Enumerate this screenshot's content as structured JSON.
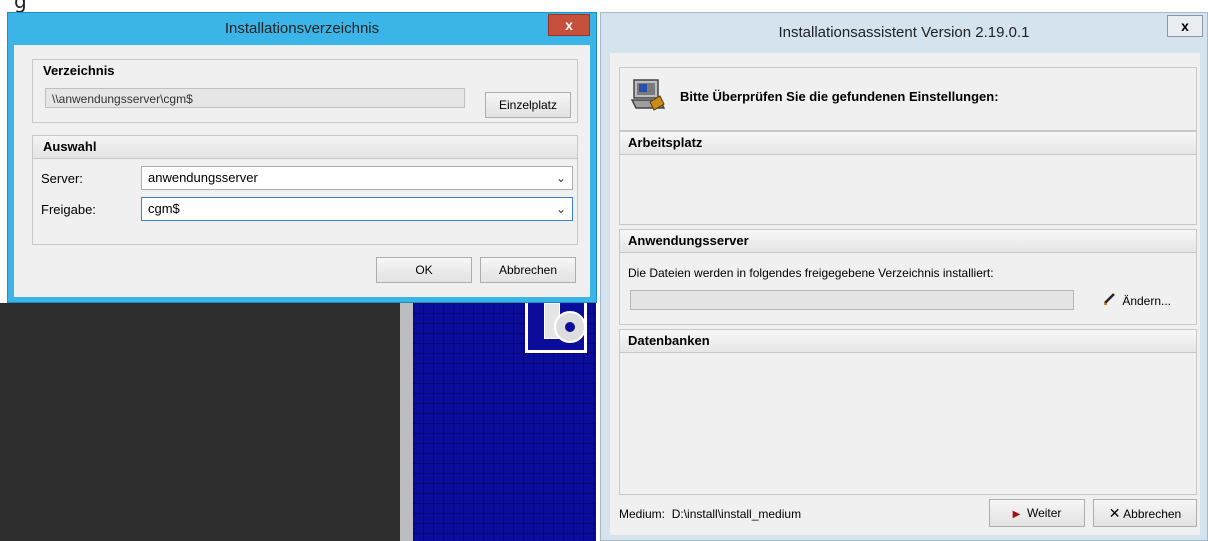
{
  "background": {
    "snippet_text": "g"
  },
  "dialog_directory": {
    "title": "Installationsverzeichnis",
    "close_label": "x",
    "group_directory": {
      "heading": "Verzeichnis",
      "path_value": "\\\\anwendungsserver\\cgm$",
      "single_button": "Einzelplatz"
    },
    "group_selection": {
      "heading": "Auswahl",
      "server_label": "Server:",
      "server_value": "anwendungsserver",
      "share_label": "Freigabe:",
      "share_value": "cgm$"
    },
    "ok_button": "OK",
    "cancel_button": "Abbrechen"
  },
  "dialog_wizard": {
    "title": "Installationsassistent  Version 2.19.0.1",
    "close_label": "x",
    "header_text": "Bitte Überprüfen Sie die gefundenen Einstellungen:",
    "section_workstation": {
      "heading": "Arbeitsplatz"
    },
    "section_appserver": {
      "heading": "Anwendungsserver",
      "description": "Die Dateien werden in folgendes freigegebene Verzeichnis installiert:",
      "path_value": "",
      "change_button": "Ändern..."
    },
    "section_databases": {
      "heading": "Datenbanken"
    },
    "medium_label": "Medium:",
    "medium_value": "D:\\install\\install_medium",
    "next_button": "Weiter",
    "cancel_button": "Abbrechen",
    "icons": {
      "install": "install-computer-icon",
      "next": "play-arrow-icon",
      "cancel": "x-cross-icon",
      "edit": "pencil-icon"
    },
    "accent_next": "#a01010"
  }
}
